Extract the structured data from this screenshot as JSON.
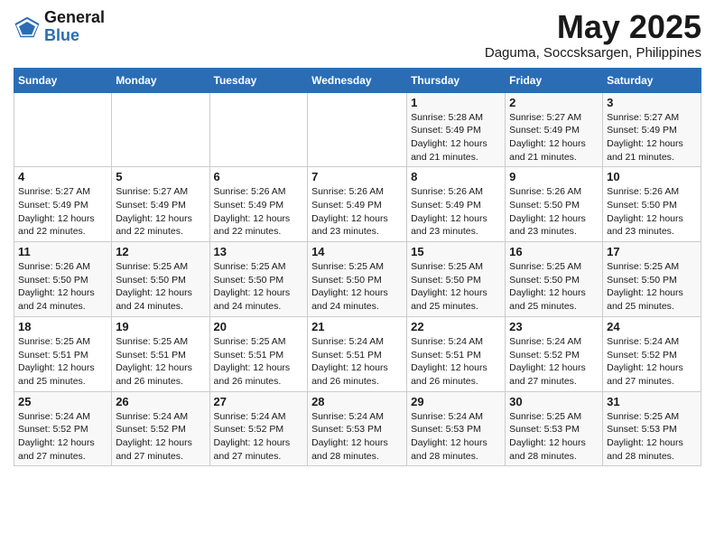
{
  "header": {
    "logo_general": "General",
    "logo_blue": "Blue",
    "month_year": "May 2025",
    "location": "Daguma, Soccsksargen, Philippines"
  },
  "days_of_week": [
    "Sunday",
    "Monday",
    "Tuesday",
    "Wednesday",
    "Thursday",
    "Friday",
    "Saturday"
  ],
  "weeks": [
    [
      {
        "day": "",
        "info": ""
      },
      {
        "day": "",
        "info": ""
      },
      {
        "day": "",
        "info": ""
      },
      {
        "day": "",
        "info": ""
      },
      {
        "day": "1",
        "info": "Sunrise: 5:28 AM\nSunset: 5:49 PM\nDaylight: 12 hours\nand 21 minutes."
      },
      {
        "day": "2",
        "info": "Sunrise: 5:27 AM\nSunset: 5:49 PM\nDaylight: 12 hours\nand 21 minutes."
      },
      {
        "day": "3",
        "info": "Sunrise: 5:27 AM\nSunset: 5:49 PM\nDaylight: 12 hours\nand 21 minutes."
      }
    ],
    [
      {
        "day": "4",
        "info": "Sunrise: 5:27 AM\nSunset: 5:49 PM\nDaylight: 12 hours\nand 22 minutes."
      },
      {
        "day": "5",
        "info": "Sunrise: 5:27 AM\nSunset: 5:49 PM\nDaylight: 12 hours\nand 22 minutes."
      },
      {
        "day": "6",
        "info": "Sunrise: 5:26 AM\nSunset: 5:49 PM\nDaylight: 12 hours\nand 22 minutes."
      },
      {
        "day": "7",
        "info": "Sunrise: 5:26 AM\nSunset: 5:49 PM\nDaylight: 12 hours\nand 23 minutes."
      },
      {
        "day": "8",
        "info": "Sunrise: 5:26 AM\nSunset: 5:49 PM\nDaylight: 12 hours\nand 23 minutes."
      },
      {
        "day": "9",
        "info": "Sunrise: 5:26 AM\nSunset: 5:50 PM\nDaylight: 12 hours\nand 23 minutes."
      },
      {
        "day": "10",
        "info": "Sunrise: 5:26 AM\nSunset: 5:50 PM\nDaylight: 12 hours\nand 23 minutes."
      }
    ],
    [
      {
        "day": "11",
        "info": "Sunrise: 5:26 AM\nSunset: 5:50 PM\nDaylight: 12 hours\nand 24 minutes."
      },
      {
        "day": "12",
        "info": "Sunrise: 5:25 AM\nSunset: 5:50 PM\nDaylight: 12 hours\nand 24 minutes."
      },
      {
        "day": "13",
        "info": "Sunrise: 5:25 AM\nSunset: 5:50 PM\nDaylight: 12 hours\nand 24 minutes."
      },
      {
        "day": "14",
        "info": "Sunrise: 5:25 AM\nSunset: 5:50 PM\nDaylight: 12 hours\nand 24 minutes."
      },
      {
        "day": "15",
        "info": "Sunrise: 5:25 AM\nSunset: 5:50 PM\nDaylight: 12 hours\nand 25 minutes."
      },
      {
        "day": "16",
        "info": "Sunrise: 5:25 AM\nSunset: 5:50 PM\nDaylight: 12 hours\nand 25 minutes."
      },
      {
        "day": "17",
        "info": "Sunrise: 5:25 AM\nSunset: 5:50 PM\nDaylight: 12 hours\nand 25 minutes."
      }
    ],
    [
      {
        "day": "18",
        "info": "Sunrise: 5:25 AM\nSunset: 5:51 PM\nDaylight: 12 hours\nand 25 minutes."
      },
      {
        "day": "19",
        "info": "Sunrise: 5:25 AM\nSunset: 5:51 PM\nDaylight: 12 hours\nand 26 minutes."
      },
      {
        "day": "20",
        "info": "Sunrise: 5:25 AM\nSunset: 5:51 PM\nDaylight: 12 hours\nand 26 minutes."
      },
      {
        "day": "21",
        "info": "Sunrise: 5:24 AM\nSunset: 5:51 PM\nDaylight: 12 hours\nand 26 minutes."
      },
      {
        "day": "22",
        "info": "Sunrise: 5:24 AM\nSunset: 5:51 PM\nDaylight: 12 hours\nand 26 minutes."
      },
      {
        "day": "23",
        "info": "Sunrise: 5:24 AM\nSunset: 5:52 PM\nDaylight: 12 hours\nand 27 minutes."
      },
      {
        "day": "24",
        "info": "Sunrise: 5:24 AM\nSunset: 5:52 PM\nDaylight: 12 hours\nand 27 minutes."
      }
    ],
    [
      {
        "day": "25",
        "info": "Sunrise: 5:24 AM\nSunset: 5:52 PM\nDaylight: 12 hours\nand 27 minutes."
      },
      {
        "day": "26",
        "info": "Sunrise: 5:24 AM\nSunset: 5:52 PM\nDaylight: 12 hours\nand 27 minutes."
      },
      {
        "day": "27",
        "info": "Sunrise: 5:24 AM\nSunset: 5:52 PM\nDaylight: 12 hours\nand 27 minutes."
      },
      {
        "day": "28",
        "info": "Sunrise: 5:24 AM\nSunset: 5:53 PM\nDaylight: 12 hours\nand 28 minutes."
      },
      {
        "day": "29",
        "info": "Sunrise: 5:24 AM\nSunset: 5:53 PM\nDaylight: 12 hours\nand 28 minutes."
      },
      {
        "day": "30",
        "info": "Sunrise: 5:25 AM\nSunset: 5:53 PM\nDaylight: 12 hours\nand 28 minutes."
      },
      {
        "day": "31",
        "info": "Sunrise: 5:25 AM\nSunset: 5:53 PM\nDaylight: 12 hours\nand 28 minutes."
      }
    ]
  ]
}
